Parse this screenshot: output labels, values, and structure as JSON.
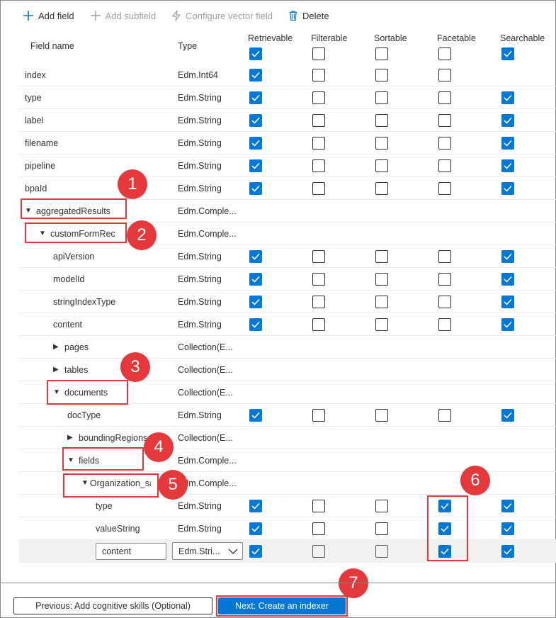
{
  "toolbar": {
    "add_field": "Add field",
    "add_subfield": "Add subfield",
    "configure_vector": "Configure vector field",
    "delete": "Delete"
  },
  "columns": {
    "field_name": "Field name",
    "type": "Type",
    "attrs": [
      {
        "label": "Retrievable",
        "checked": true
      },
      {
        "label": "Filterable",
        "checked": false
      },
      {
        "label": "Sortable",
        "checked": false
      },
      {
        "label": "Facetable",
        "checked": false
      },
      {
        "label": "Searchable",
        "checked": true
      }
    ]
  },
  "rows": [
    {
      "name": "index",
      "type": "Edm.Int64",
      "indent": 0,
      "caret": "",
      "checks": [
        true,
        false,
        false,
        false,
        null
      ]
    },
    {
      "name": "type",
      "type": "Edm.String",
      "indent": 0,
      "caret": "",
      "checks": [
        true,
        false,
        false,
        false,
        true
      ]
    },
    {
      "name": "label",
      "type": "Edm.String",
      "indent": 0,
      "caret": "",
      "checks": [
        true,
        false,
        false,
        false,
        true
      ]
    },
    {
      "name": "filename",
      "type": "Edm.String",
      "indent": 0,
      "caret": "",
      "checks": [
        true,
        false,
        false,
        false,
        true
      ]
    },
    {
      "name": "pipeline",
      "type": "Edm.String",
      "indent": 0,
      "caret": "",
      "checks": [
        true,
        false,
        false,
        false,
        true
      ]
    },
    {
      "name": "bpaId",
      "type": "Edm.String",
      "indent": 0,
      "caret": "",
      "checks": [
        true,
        false,
        false,
        false,
        true
      ]
    },
    {
      "name": "aggregatedResults",
      "type": "Edm.Comple...",
      "indent": 0,
      "caret": "expanded",
      "checks": null
    },
    {
      "name": "customFormRec",
      "type": "Edm.Comple...",
      "indent": 1,
      "caret": "expanded",
      "checks": null
    },
    {
      "name": "apiVersion",
      "type": "Edm.String",
      "indent": 2,
      "caret": "",
      "checks": [
        true,
        false,
        false,
        false,
        true
      ]
    },
    {
      "name": "modelId",
      "type": "Edm.String",
      "indent": 2,
      "caret": "",
      "checks": [
        true,
        false,
        false,
        false,
        true
      ]
    },
    {
      "name": "stringIndexType",
      "type": "Edm.String",
      "indent": 2,
      "caret": "",
      "checks": [
        true,
        false,
        false,
        false,
        true
      ]
    },
    {
      "name": "content",
      "type": "Edm.String",
      "indent": 2,
      "caret": "",
      "checks": [
        true,
        false,
        false,
        false,
        true
      ]
    },
    {
      "name": "pages",
      "type": "Collection(E...",
      "indent": 2,
      "caret": "collapsed",
      "checks": null
    },
    {
      "name": "tables",
      "type": "Collection(E...",
      "indent": 2,
      "caret": "collapsed",
      "checks": null
    },
    {
      "name": "documents",
      "type": "Collection(E...",
      "indent": 2,
      "caret": "expanded",
      "checks": null
    },
    {
      "name": "docType",
      "type": "Edm.String",
      "indent": 3,
      "caret": "",
      "checks": [
        true,
        false,
        false,
        false,
        true
      ]
    },
    {
      "name": "boundingRegions",
      "type": "Collection(E...",
      "indent": 3,
      "caret": "collapsed",
      "checks": null
    },
    {
      "name": "fields",
      "type": "Edm.Comple...",
      "indent": 3,
      "caret": "expanded",
      "checks": null
    },
    {
      "name": "Organization_sam...",
      "type": "Edm.Comple...",
      "indent": 4,
      "caret": "expanded",
      "checks": null
    },
    {
      "name": "type",
      "type": "Edm.String",
      "indent": 5,
      "caret": "",
      "checks": [
        true,
        false,
        false,
        true,
        true
      ]
    },
    {
      "name": "valueString",
      "type": "Edm.String",
      "indent": 5,
      "caret": "",
      "checks": [
        true,
        false,
        false,
        true,
        true
      ]
    }
  ],
  "edit_row": {
    "name_value": "content",
    "type_value": "Edm.Stri...",
    "checks": [
      true,
      false,
      false,
      true,
      true
    ]
  },
  "annotations": [
    "1",
    "2",
    "3",
    "4",
    "5",
    "6",
    "7"
  ],
  "footer": {
    "previous": "Previous: Add cognitive skills (Optional)",
    "next": "Next: Create an indexer"
  },
  "colors": {
    "accent": "#0078d4",
    "annotation": "#e5383b"
  }
}
